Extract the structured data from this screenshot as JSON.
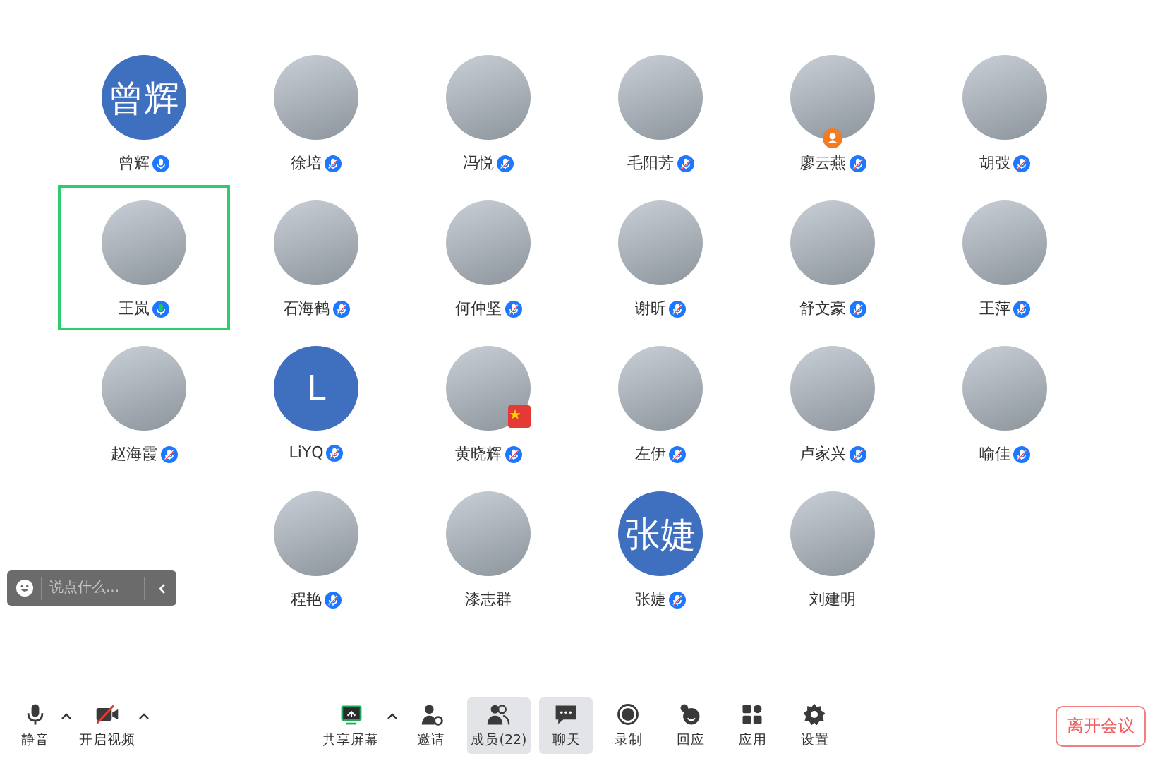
{
  "participants": [
    {
      "name": "曾辉",
      "avatar": {
        "kind": "initials",
        "text": "曾辉"
      },
      "mic": {
        "muted": false,
        "speaking": false
      },
      "selected": false
    },
    {
      "name": "徐培",
      "avatar": {
        "kind": "photo"
      },
      "mic": {
        "muted": true,
        "speaking": false
      },
      "selected": false
    },
    {
      "name": "冯悦",
      "avatar": {
        "kind": "photo"
      },
      "mic": {
        "muted": true,
        "speaking": false
      },
      "selected": false
    },
    {
      "name": "毛阳芳",
      "avatar": {
        "kind": "photo"
      },
      "mic": {
        "muted": true,
        "speaking": false
      },
      "selected": false
    },
    {
      "name": "廖云燕",
      "avatar": {
        "kind": "photo"
      },
      "mic": {
        "muted": true,
        "speaking": false
      },
      "badge": {
        "kind": "person"
      },
      "selected": false
    },
    {
      "name": "胡弢",
      "avatar": {
        "kind": "photo"
      },
      "mic": {
        "muted": true,
        "speaking": false
      },
      "selected": false
    },
    {
      "name": "王岚",
      "avatar": {
        "kind": "photo"
      },
      "mic": {
        "muted": false,
        "speaking": true
      },
      "selected": true
    },
    {
      "name": "石海鹤",
      "avatar": {
        "kind": "photo"
      },
      "mic": {
        "muted": true,
        "speaking": false
      },
      "selected": false
    },
    {
      "name": "何仲坚",
      "avatar": {
        "kind": "photo"
      },
      "mic": {
        "muted": true,
        "speaking": false
      },
      "selected": false
    },
    {
      "name": "谢昕",
      "avatar": {
        "kind": "photo"
      },
      "mic": {
        "muted": true,
        "speaking": false
      },
      "selected": false
    },
    {
      "name": "舒文豪",
      "avatar": {
        "kind": "photo"
      },
      "mic": {
        "muted": true,
        "speaking": false
      },
      "selected": false
    },
    {
      "name": "王萍",
      "avatar": {
        "kind": "photo"
      },
      "mic": {
        "muted": true,
        "speaking": false
      },
      "selected": false
    },
    {
      "name": "赵海霞",
      "avatar": {
        "kind": "photo"
      },
      "mic": {
        "muted": true,
        "speaking": false
      },
      "selected": false
    },
    {
      "name": "LiYQ",
      "avatar": {
        "kind": "initials",
        "text": "L"
      },
      "mic": {
        "muted": true,
        "speaking": false
      },
      "selected": false
    },
    {
      "name": "黄晓辉",
      "avatar": {
        "kind": "photo"
      },
      "mic": {
        "muted": true,
        "speaking": false
      },
      "badge": {
        "kind": "flag"
      },
      "selected": false
    },
    {
      "name": "左伊",
      "avatar": {
        "kind": "photo"
      },
      "mic": {
        "muted": true,
        "speaking": false
      },
      "selected": false
    },
    {
      "name": "卢家兴",
      "avatar": {
        "kind": "photo"
      },
      "mic": {
        "muted": true,
        "speaking": false
      },
      "selected": false
    },
    {
      "name": "喻佳",
      "avatar": {
        "kind": "photo"
      },
      "mic": {
        "muted": true,
        "speaking": false
      },
      "selected": false
    },
    {
      "name": "程艳",
      "avatar": {
        "kind": "photo"
      },
      "mic": {
        "muted": true,
        "speaking": false
      },
      "selected": false
    },
    {
      "name": "漆志群",
      "avatar": {
        "kind": "photo"
      },
      "selected": false
    },
    {
      "name": "张婕",
      "avatar": {
        "kind": "initials",
        "text": "张婕"
      },
      "mic": {
        "muted": true,
        "speaking": false
      },
      "selected": false
    },
    {
      "name": "刘建明",
      "avatar": {
        "kind": "photo"
      },
      "selected": false
    }
  ],
  "chat_bar": {
    "placeholder": "说点什么..."
  },
  "toolbar": {
    "left": [
      {
        "kind": "mic",
        "label": "静音",
        "on": true,
        "caret": true
      },
      {
        "kind": "video",
        "label": "开启视频",
        "on": false,
        "caret": true
      }
    ],
    "center": [
      {
        "kind": "share",
        "label": "共享屏幕",
        "caret": true,
        "selected": false
      },
      {
        "kind": "invite",
        "label": "邀请",
        "caret": false,
        "selected": false
      },
      {
        "kind": "members",
        "label": "成员(22)",
        "caret": false,
        "selected": true
      },
      {
        "kind": "chat",
        "label": "聊天",
        "caret": false,
        "selected": true
      },
      {
        "kind": "record",
        "label": "录制",
        "caret": false,
        "selected": false
      },
      {
        "kind": "reaction",
        "label": "回应",
        "caret": false,
        "selected": false
      },
      {
        "kind": "apps",
        "label": "应用",
        "caret": false,
        "selected": false
      },
      {
        "kind": "settings",
        "label": "设置",
        "caret": false,
        "selected": false
      }
    ],
    "leave_button": "离开会议"
  }
}
